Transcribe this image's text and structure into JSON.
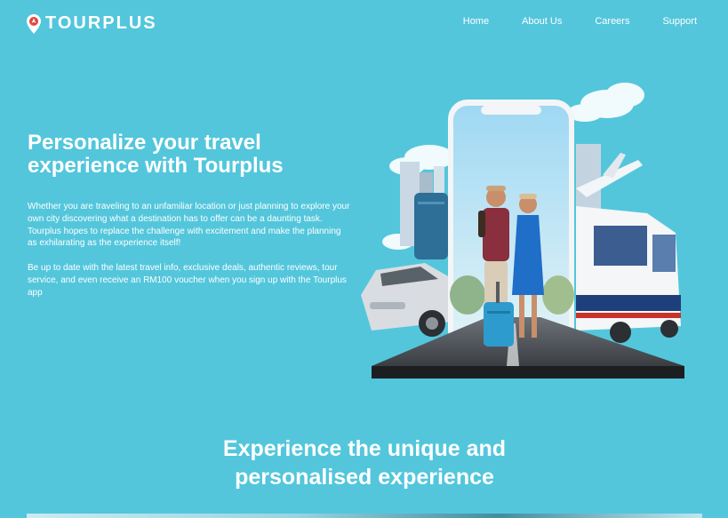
{
  "header": {
    "logo_text": "TOURPLUS",
    "nav": [
      "Home",
      "About Us",
      "Careers",
      "Support"
    ]
  },
  "hero": {
    "title_line1": "Personalize your travel",
    "title_line2": "experience with Tourplus",
    "paragraph1": "Whether you are traveling to an unfamiliar location or just planning to explore your own city discovering what a destination has to offer can be a daunting task. Tourplus hopes to replace the challenge with excitement and make the planning as exhilarating as the experience itself!",
    "paragraph2": "Be up to date with the latest travel info, exclusive deals, authentic reviews, tour service, and even receive an RM100 voucher when you sign up with the Tourplus app"
  },
  "section": {
    "title_line1": "Experience the unique and",
    "title_line2": "personalised experience"
  },
  "colors": {
    "background": "#53c6dc",
    "text": "#ffffff",
    "logo_pin": "#e5453a"
  },
  "icons": [
    "location-pin-icon"
  ]
}
